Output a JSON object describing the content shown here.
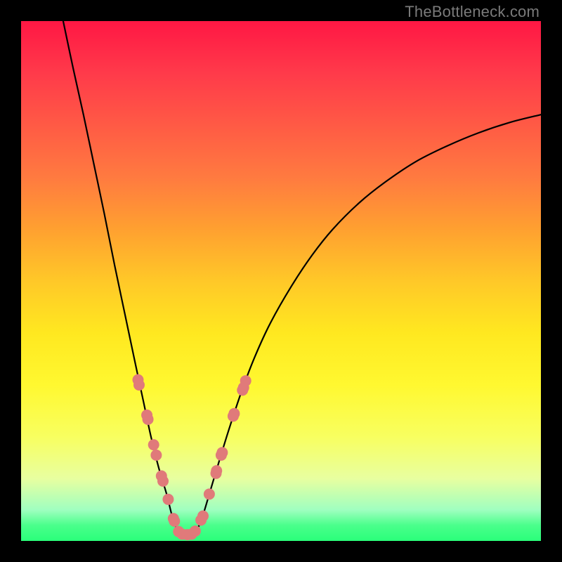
{
  "watermark_text": "TheBottleneck.com",
  "chart_data": {
    "type": "line",
    "title": "",
    "xlabel": "",
    "ylabel": "",
    "xlim": [
      0,
      100
    ],
    "ylim": [
      0,
      100
    ],
    "curve": [
      {
        "x": 8.1,
        "y": 100.0
      },
      {
        "x": 10.0,
        "y": 91.0
      },
      {
        "x": 12.0,
        "y": 82.0
      },
      {
        "x": 14.0,
        "y": 72.5
      },
      {
        "x": 16.0,
        "y": 63.0
      },
      {
        "x": 18.0,
        "y": 53.0
      },
      {
        "x": 20.0,
        "y": 43.5
      },
      {
        "x": 22.0,
        "y": 34.0
      },
      {
        "x": 23.5,
        "y": 27.0
      },
      {
        "x": 25.0,
        "y": 20.0
      },
      {
        "x": 26.5,
        "y": 14.0
      },
      {
        "x": 28.0,
        "y": 9.0
      },
      {
        "x": 29.0,
        "y": 5.0
      },
      {
        "x": 30.0,
        "y": 2.2
      },
      {
        "x": 31.0,
        "y": 1.2
      },
      {
        "x": 32.8,
        "y": 1.2
      },
      {
        "x": 34.0,
        "y": 2.5
      },
      {
        "x": 35.0,
        "y": 5.0
      },
      {
        "x": 36.5,
        "y": 10.0
      },
      {
        "x": 38.0,
        "y": 15.0
      },
      {
        "x": 40.0,
        "y": 21.5
      },
      {
        "x": 42.5,
        "y": 29.0
      },
      {
        "x": 45.0,
        "y": 35.5
      },
      {
        "x": 48.0,
        "y": 42.0
      },
      {
        "x": 52.0,
        "y": 49.0
      },
      {
        "x": 56.0,
        "y": 55.0
      },
      {
        "x": 60.0,
        "y": 60.0
      },
      {
        "x": 65.0,
        "y": 65.0
      },
      {
        "x": 70.0,
        "y": 69.0
      },
      {
        "x": 76.0,
        "y": 73.0
      },
      {
        "x": 82.0,
        "y": 76.0
      },
      {
        "x": 88.0,
        "y": 78.5
      },
      {
        "x": 94.0,
        "y": 80.5
      },
      {
        "x": 100.0,
        "y": 82.0
      }
    ],
    "markers": [
      {
        "x": 22.5,
        "y": 31.0
      },
      {
        "x": 22.7,
        "y": 30.0
      },
      {
        "x": 24.2,
        "y": 24.2
      },
      {
        "x": 24.4,
        "y": 23.4
      },
      {
        "x": 25.5,
        "y": 18.5
      },
      {
        "x": 26.0,
        "y": 16.5
      },
      {
        "x": 27.0,
        "y": 12.5
      },
      {
        "x": 27.3,
        "y": 11.5
      },
      {
        "x": 28.3,
        "y": 8.0
      },
      {
        "x": 29.3,
        "y": 4.3
      },
      {
        "x": 29.5,
        "y": 3.8
      },
      {
        "x": 30.3,
        "y": 1.8
      },
      {
        "x": 31.0,
        "y": 1.3
      },
      {
        "x": 32.0,
        "y": 1.2
      },
      {
        "x": 32.8,
        "y": 1.3
      },
      {
        "x": 33.5,
        "y": 1.9
      },
      {
        "x": 34.6,
        "y": 4.0
      },
      {
        "x": 35.0,
        "y": 4.8
      },
      {
        "x": 36.2,
        "y": 9.0
      },
      {
        "x": 37.5,
        "y": 13.0
      },
      {
        "x": 37.6,
        "y": 13.5
      },
      {
        "x": 38.5,
        "y": 16.5
      },
      {
        "x": 38.7,
        "y": 17.0
      },
      {
        "x": 40.8,
        "y": 24.0
      },
      {
        "x": 41.0,
        "y": 24.5
      },
      {
        "x": 42.6,
        "y": 29.0
      },
      {
        "x": 42.8,
        "y": 29.5
      },
      {
        "x": 43.2,
        "y": 30.8
      }
    ],
    "marker_radius_px": 8
  }
}
